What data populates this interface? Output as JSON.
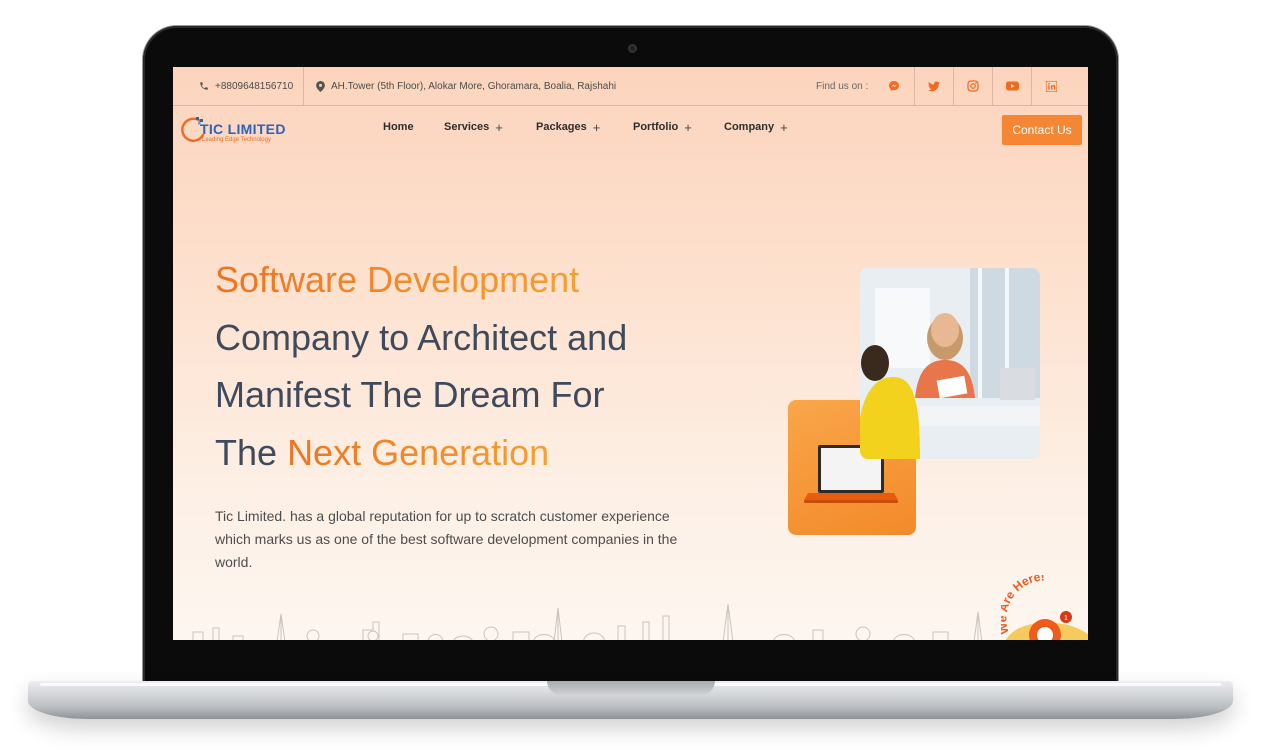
{
  "topbar": {
    "phone": "+8809648156710",
    "address": "AH.Tower (5th Floor), Alokar More, Ghoramara, Boalia, Rajshahi",
    "find_us": "Find us on :",
    "socials": [
      "messenger-icon",
      "twitter-icon",
      "instagram-icon",
      "youtube-icon",
      "linkedin-icon"
    ]
  },
  "logo": {
    "brand": "TIC LIMITED",
    "tagline": "Leading Edge Technology"
  },
  "nav": {
    "items": [
      {
        "label": "Home",
        "has_submenu": false
      },
      {
        "label": "Services",
        "has_submenu": true
      },
      {
        "label": "Packages",
        "has_submenu": true
      },
      {
        "label": "Portfolio",
        "has_submenu": true
      },
      {
        "label": "Company",
        "has_submenu": true
      }
    ],
    "submenu_glyph": "+",
    "cta": "Contact Us"
  },
  "hero": {
    "line1": "Software Development",
    "line2": "Company to Architect and",
    "line3": "Manifest The Dream For",
    "line4_prefix": "The",
    "line4_highlight": "Next Generation",
    "description": "Tic Limited. has a global reputation for up to scratch customer experience which marks us as one of the best software development companies in the world."
  },
  "chat_widget": {
    "label": "We Are Here!",
    "badge_count": "1"
  },
  "colors": {
    "accent": "#f0731f",
    "button": "#f58634",
    "heading": "#3f4a5c",
    "logo_blue": "#2e61b8"
  }
}
